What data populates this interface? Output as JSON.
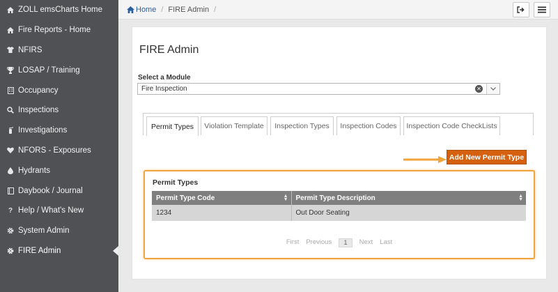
{
  "sidebar": {
    "items": [
      {
        "label": "ZOLL emsCharts Home",
        "icon": "home-icon"
      },
      {
        "label": "Fire Reports - Home",
        "icon": "home-icon"
      },
      {
        "label": "NFIRS",
        "icon": "shirt-icon"
      },
      {
        "label": "LOSAP / Training",
        "icon": "trophy-icon"
      },
      {
        "label": "Occupancy",
        "icon": "building-icon"
      },
      {
        "label": "Inspections",
        "icon": "search-icon"
      },
      {
        "label": "Investigations",
        "icon": "fire-extinguisher-icon"
      },
      {
        "label": "NFORS - Exposures",
        "icon": "heart-icon"
      },
      {
        "label": "Hydrants",
        "icon": "drop-icon"
      },
      {
        "label": "Daybook / Journal",
        "icon": "book-icon"
      },
      {
        "label": "Help / What's New",
        "icon": "question-icon"
      },
      {
        "label": "System Admin",
        "icon": "gear-icon"
      },
      {
        "label": "FIRE Admin",
        "icon": "gear-icon",
        "active": true
      }
    ]
  },
  "breadcrumb": {
    "home": "Home",
    "current": "FIRE Admin",
    "sep": "/"
  },
  "page": {
    "title": "FIRE Admin",
    "module_label": "Select a Module",
    "module_value": "Fire Inspection"
  },
  "tabs": [
    {
      "label": "Permit Types",
      "active": true
    },
    {
      "label": "Violation Template"
    },
    {
      "label": "Inspection Types"
    },
    {
      "label": "Inspection Codes"
    },
    {
      "label": "Inspection Code CheckLists"
    }
  ],
  "add_button": "Add New Permit Type",
  "permit_types": {
    "title": "Permit Types",
    "columns": [
      "Permit Type Code",
      "Permit Type Description"
    ],
    "rows": [
      [
        "1234",
        "Out Door Seating"
      ]
    ]
  },
  "pager": {
    "first": "First",
    "previous": "Previous",
    "current": "1",
    "next": "Next",
    "last": "Last"
  },
  "colors": {
    "sidebar_bg": "#4f5155",
    "accent_button": "#d46010",
    "highlight": "#f3a33b",
    "table_header": "#7f7f7f"
  }
}
